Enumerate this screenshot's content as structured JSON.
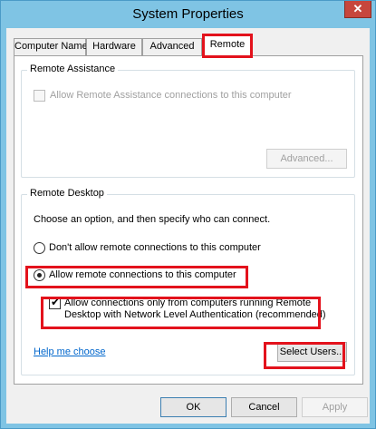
{
  "window": {
    "title": "System Properties",
    "close_glyph": "✕"
  },
  "tabs": [
    {
      "label": "Computer Name"
    },
    {
      "label": "Hardware"
    },
    {
      "label": "Advanced"
    },
    {
      "label": "Remote"
    }
  ],
  "remote_assistance": {
    "title": "Remote Assistance",
    "allow_label": "Allow Remote Assistance connections to this computer",
    "allow_checked": false,
    "advanced_label": "Advanced..."
  },
  "remote_desktop": {
    "title": "Remote Desktop",
    "instruction": "Choose an option, and then specify who can connect.",
    "option_dont_allow": "Don't allow remote connections to this computer",
    "option_allow": "Allow remote connections to this computer",
    "selected_option": "allow",
    "nla_label_line1": "Allow connections only from computers running Remote",
    "nla_label_line2": "Desktop with Network Level Authentication (recommended)",
    "nla_checked": true,
    "help_link": "Help me choose",
    "select_users_label": "Select Users..."
  },
  "footer": {
    "ok_label": "OK",
    "cancel_label": "Cancel",
    "apply_label": "Apply"
  },
  "icons": {
    "check": "✔"
  },
  "colors": {
    "highlight": "#e3121c",
    "link": "#0066cc",
    "titlebar": "#7fc4e4",
    "close": "#c7463d"
  }
}
